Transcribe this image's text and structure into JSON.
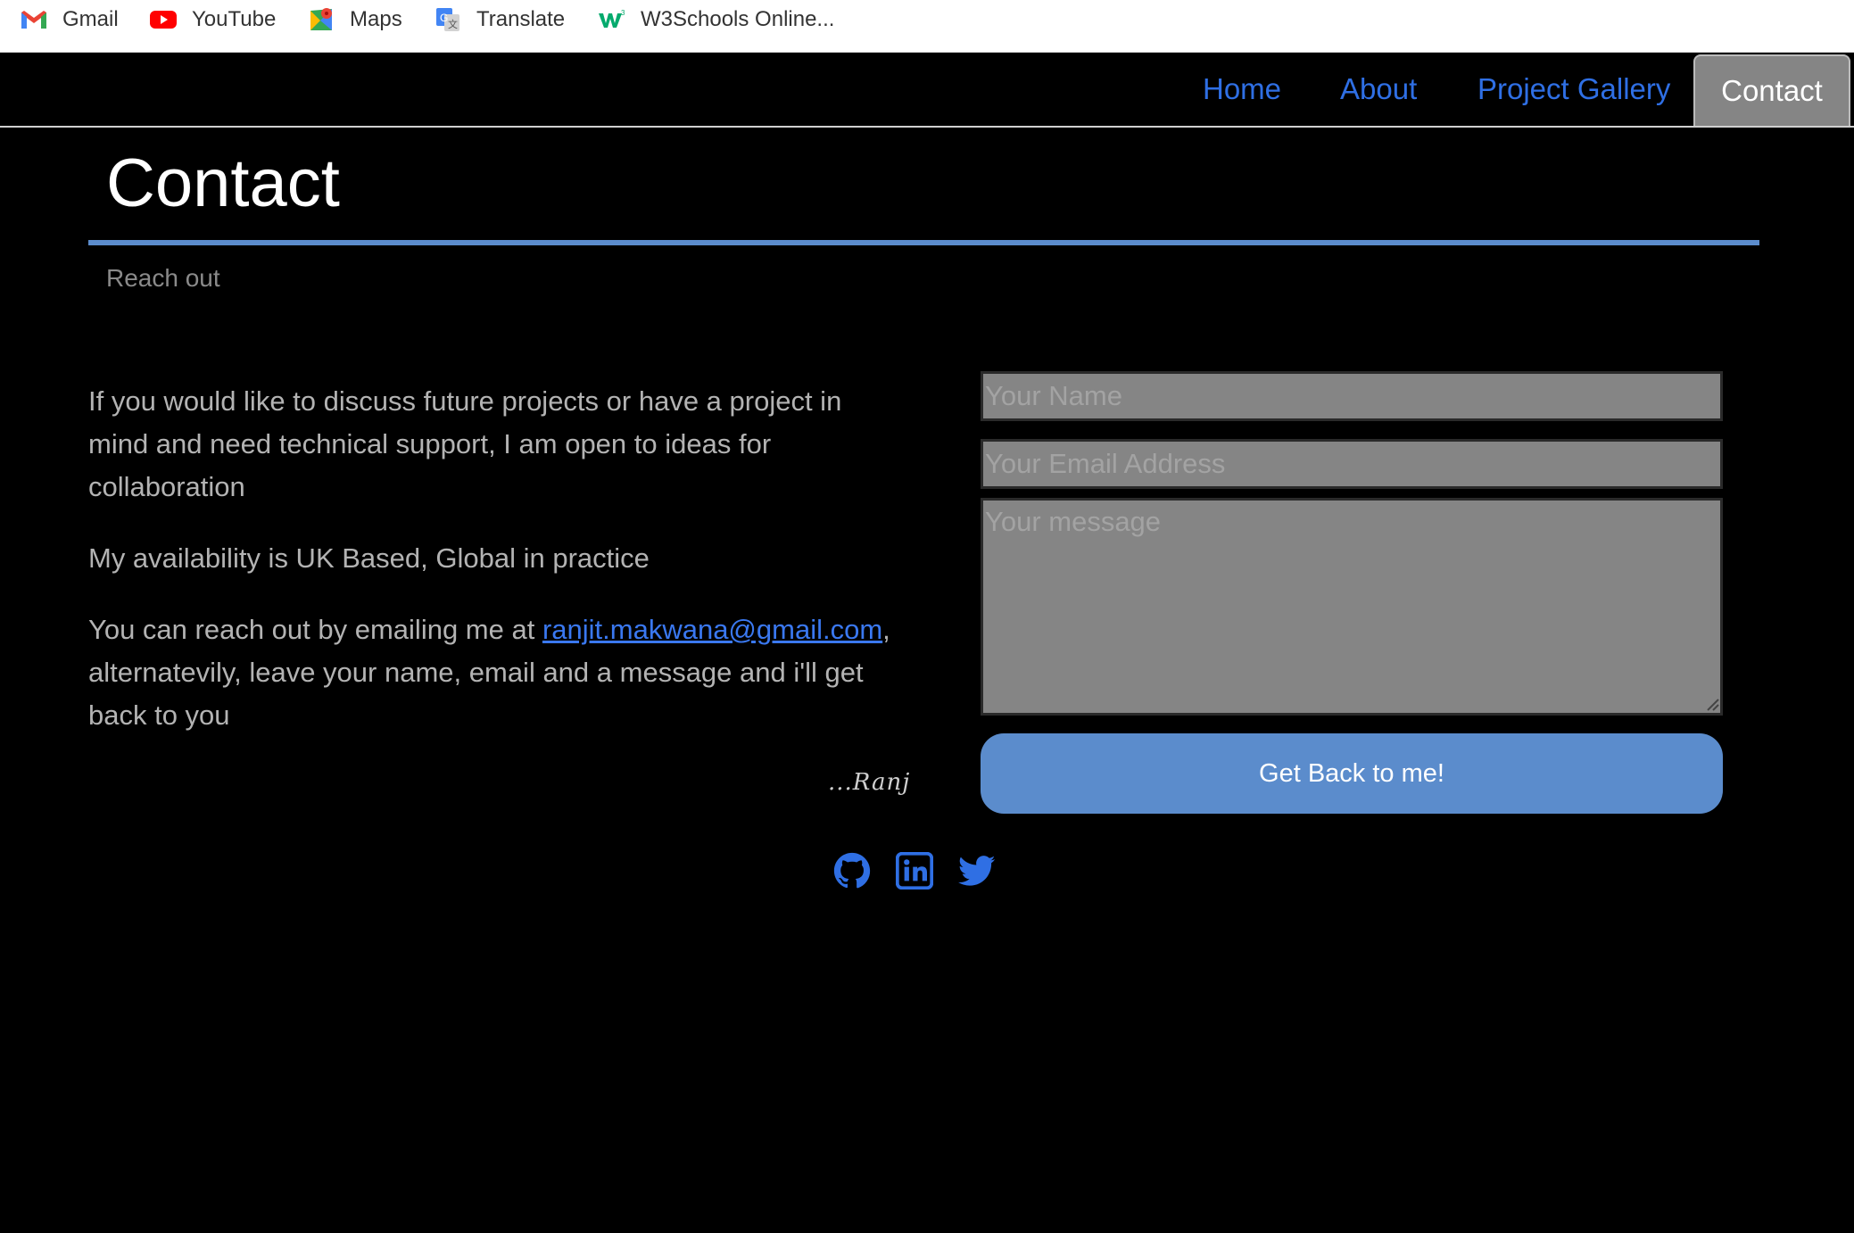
{
  "bookmarks": [
    {
      "label": "Gmail",
      "icon": "gmail-icon"
    },
    {
      "label": "YouTube",
      "icon": "youtube-icon"
    },
    {
      "label": "Maps",
      "icon": "maps-icon"
    },
    {
      "label": "Translate",
      "icon": "translate-icon"
    },
    {
      "label": "W3Schools Online...",
      "icon": "w3schools-icon"
    }
  ],
  "nav": {
    "items": [
      "Home",
      "About",
      "Project Gallery"
    ],
    "active": "Contact"
  },
  "page": {
    "title": "Contact",
    "subtitle": "Reach out"
  },
  "content": {
    "paragraph1": "If you would like to discuss future projects or have a project in mind and need technical support, I am open to ideas for collaboration",
    "paragraph2": "My availability is UK Based, Global in practice",
    "paragraph3_before": "You can reach out by emailing me at ",
    "email": "ranjit.makwana@gmail.com",
    "paragraph3_after": ", alternatevily, leave your name, email and a message and i'll get back to you",
    "signature": "...Ranj"
  },
  "form": {
    "name_placeholder": "Your Name",
    "email_placeholder": "Your Email Address",
    "message_placeholder": "Your message",
    "submit_label": "Get Back to me!"
  },
  "social": [
    "github-icon",
    "linkedin-icon",
    "twitter-icon"
  ],
  "colors": {
    "accent": "#5b8ccc",
    "link": "#2f6fe4",
    "background": "#000000",
    "field": "#858585"
  }
}
